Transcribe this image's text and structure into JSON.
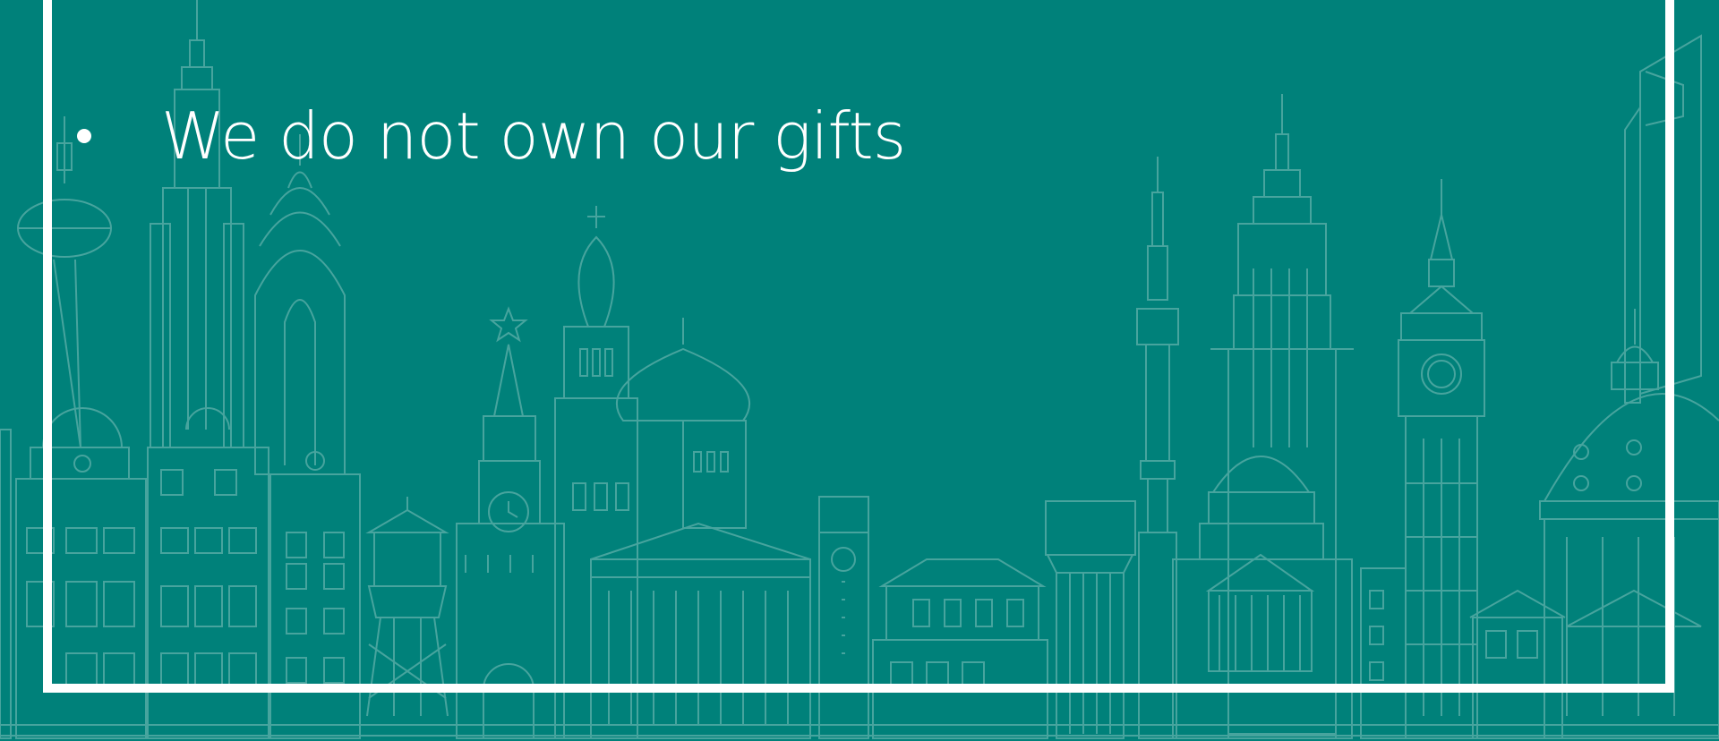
{
  "slide": {
    "bullets": [
      {
        "text": "We do not own our gifts"
      }
    ]
  },
  "colors": {
    "background": "#00817a",
    "line_art": "#5fb0aa",
    "frame": "#ffffff",
    "text": "#ffffff"
  },
  "background_icon": "city-skyline-line-art"
}
